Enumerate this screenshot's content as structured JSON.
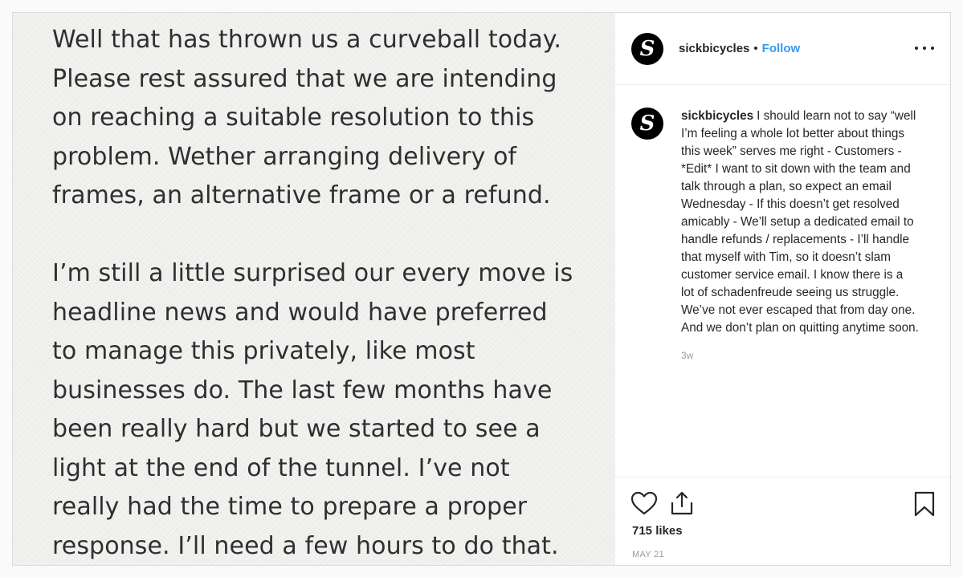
{
  "media": {
    "paragraph1_lines": [
      "Well that has thrown us a curveball today.",
      "Please rest assured that we are intending",
      "on reaching a suitable resolution to this",
      "problem. Wether arranging delivery of",
      "frames, an alternative frame or a refund."
    ],
    "paragraph2_lines": [
      "I’m still a little surprised our every move is",
      "headline news and would have preferred",
      "to manage this privately, like most",
      "businesses do. The last few months have",
      "been really hard but we started to see a",
      "light at the end of the tunnel.  I’ve not",
      "really had the time to prepare a proper",
      "response. I’ll need a few hours to do that."
    ]
  },
  "header": {
    "avatar_letter": "S",
    "username": "sickbicycles",
    "separator": "•",
    "follow_label": "Follow",
    "more_icon": "ellipsis-icon"
  },
  "comment": {
    "avatar_letter": "S",
    "username": "sickbicycles",
    "text": "I should learn not to say “well I’m feeling a whole lot better about things this week” serves me right - Customers - *Edit* I want to sit down with the team and talk through a plan, so expect an email Wednesday - If this doesn’t get resolved amicably - We’ll setup a dedicated email to handle refunds / replacements - I’ll handle that myself with Tim, so it doesn’t slam customer service email. I know there is a lot of schadenfreude seeing us struggle. We’ve not ever escaped that from day one. And we don’t plan on quitting anytime soon.",
    "time": "3w"
  },
  "actions": {
    "like_icon": "heart-icon",
    "share_icon": "share-icon",
    "save_icon": "bookmark-icon",
    "likes_text": "715 likes",
    "date_text": "MAY 21"
  },
  "colors": {
    "link": "#3897f0",
    "text": "#262626",
    "muted": "#999999",
    "border": "#dbdbdb"
  }
}
